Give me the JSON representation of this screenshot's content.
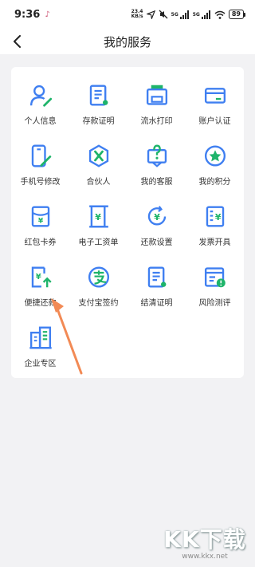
{
  "status_bar": {
    "time": "9:36",
    "note_icon": "music-note",
    "net_speed_value": "23.4",
    "net_speed_unit": "KB/s",
    "sig1": "5G",
    "sig2": "5G",
    "battery": "89"
  },
  "header": {
    "title": "我的服务",
    "back_icon": "chevron-left"
  },
  "colors": {
    "icon_blue": "#3f7ff1",
    "icon_green": "#1eb46a",
    "arrow": "#f28a55"
  },
  "services": [
    {
      "label": "个人信息",
      "icon": "person-icon"
    },
    {
      "label": "存款证明",
      "icon": "deposit-certificate-icon"
    },
    {
      "label": "流水打印",
      "icon": "printer-icon"
    },
    {
      "label": "账户认证",
      "icon": "card-icon"
    },
    {
      "label": "手机号修改",
      "icon": "phone-edit-icon"
    },
    {
      "label": "合伙人",
      "icon": "partner-icon"
    },
    {
      "label": "我的客服",
      "icon": "customer-service-icon"
    },
    {
      "label": "我的积分",
      "icon": "points-star-icon"
    },
    {
      "label": "红包卡券",
      "icon": "red-packet-icon"
    },
    {
      "label": "电子工资单",
      "icon": "payslip-icon"
    },
    {
      "label": "还款设置",
      "icon": "repay-setting-icon"
    },
    {
      "label": "发票开具",
      "icon": "invoice-icon"
    },
    {
      "label": "便捷还款",
      "icon": "quick-repay-icon"
    },
    {
      "label": "支付宝签约",
      "icon": "alipay-icon"
    },
    {
      "label": "结清证明",
      "icon": "settlement-certificate-icon"
    },
    {
      "label": "风险测评",
      "icon": "risk-assessment-icon"
    },
    {
      "label": "企业专区",
      "icon": "enterprise-icon"
    }
  ],
  "watermark": {
    "logo": "KK下载",
    "url": "www.kkx.net"
  }
}
